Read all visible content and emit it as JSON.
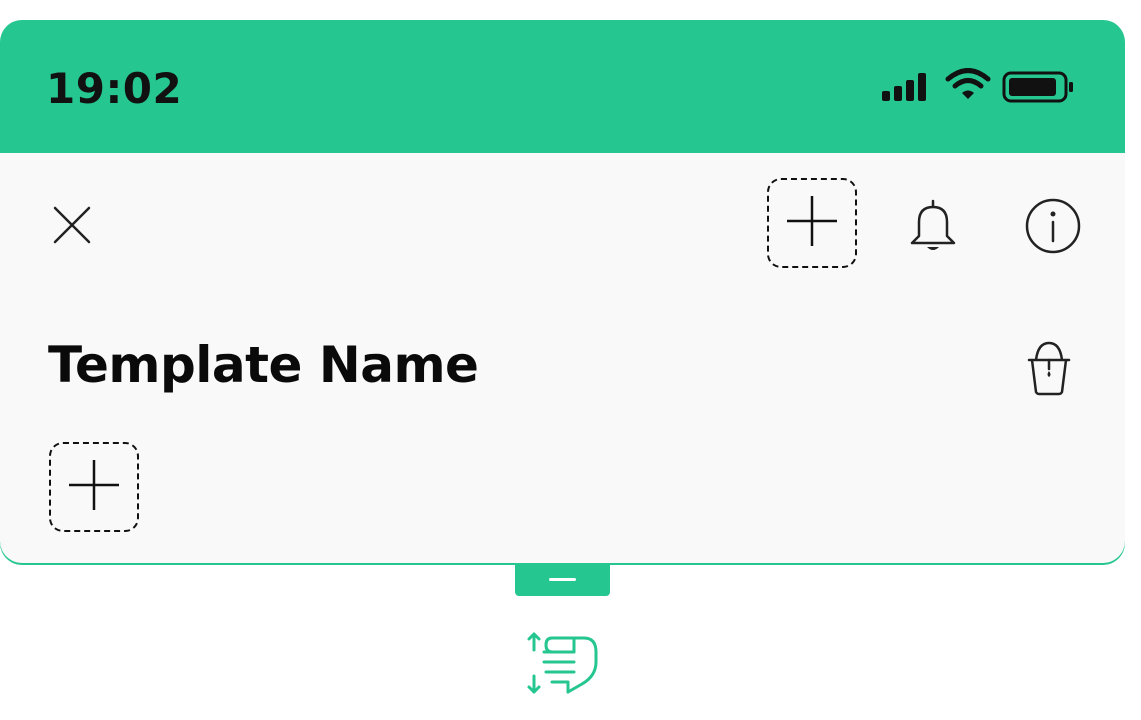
{
  "status_bar": {
    "time": "19:02",
    "icons": [
      "signal-icon",
      "wifi-icon",
      "battery-icon"
    ]
  },
  "toolbar": {
    "left_icon": "close-icon",
    "right_icons": [
      "add-icon",
      "bell-icon",
      "info-icon"
    ]
  },
  "template": {
    "name": "Template Name",
    "action_icon": "paint-bucket-icon",
    "add_slot_icon": "add-icon"
  },
  "drag_handle": {
    "icon": "minus-icon",
    "hint_icon": "swipe-vertical-gesture-icon"
  },
  "colors": {
    "accent": "#25c690",
    "background": "#f9f9f9",
    "text": "#0a0a0a"
  }
}
